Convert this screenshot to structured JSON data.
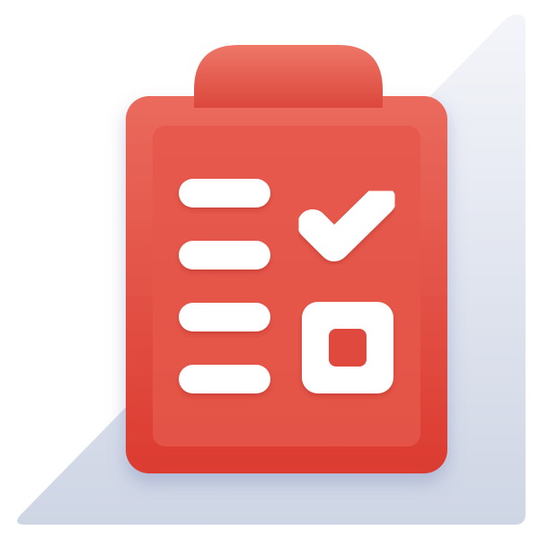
{
  "icon": {
    "name": "clipboard-checklist-icon",
    "colors": {
      "background_shape_light": "#f4f5fa",
      "background_shape_dark": "#ced5e4",
      "board_top": "#ea6a5d",
      "board_bottom": "#dc3b30",
      "clip_top": "#ee7768",
      "clip_bottom": "#dc473c",
      "inner_panel": "#e5574a",
      "marks": "#ffffff"
    },
    "checklist": {
      "rows": 4,
      "checked_item": true,
      "unchecked_item": true
    }
  }
}
